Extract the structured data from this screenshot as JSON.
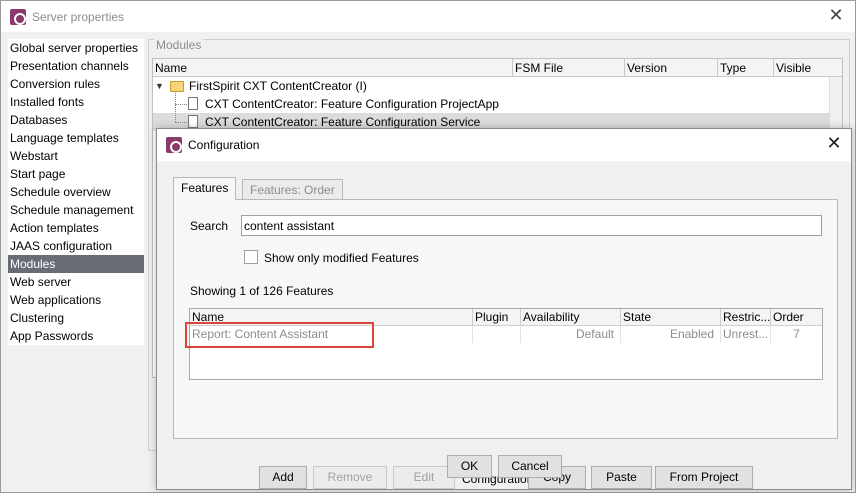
{
  "window": {
    "title": "Server properties"
  },
  "sidebar": {
    "items": [
      {
        "label": "Global server properties"
      },
      {
        "label": "Presentation channels"
      },
      {
        "label": "Conversion rules"
      },
      {
        "label": "Installed fonts"
      },
      {
        "label": "Databases"
      },
      {
        "label": "Language templates"
      },
      {
        "label": "Webstart"
      },
      {
        "label": "Start page"
      },
      {
        "label": "Schedule overview"
      },
      {
        "label": "Schedule management"
      },
      {
        "label": "Action templates"
      },
      {
        "label": "JAAS configuration"
      },
      {
        "label": "Modules",
        "selected": true
      },
      {
        "label": "Web server"
      },
      {
        "label": "Web applications"
      },
      {
        "label": "Clustering"
      },
      {
        "label": "App Passwords"
      }
    ]
  },
  "modules": {
    "legend": "Modules",
    "columns": [
      "Name",
      "FSM File",
      "Version",
      "Type",
      "Visible"
    ],
    "rows": [
      {
        "label": "FirstSpirit CXT ContentCreator (I)",
        "kind": "folder"
      },
      {
        "label": "CXT ContentCreator: Feature Configuration ProjectApp",
        "kind": "file"
      },
      {
        "label": "CXT ContentCreator: Feature Configuration Service",
        "kind": "file",
        "selected": true
      }
    ]
  },
  "dialog": {
    "title": "Configuration",
    "tabs": [
      {
        "label": "Features"
      },
      {
        "label": "Features: Order"
      }
    ],
    "search_label": "Search",
    "search_value": "content assistant",
    "checkbox_label": "Show only modified Features",
    "checkbox_checked": false,
    "showing_text": "Showing 1 of 126 Features",
    "table": {
      "columns": [
        "Name",
        "Plugin",
        "Availability",
        "State",
        "Restric...",
        "Order"
      ],
      "rows": [
        {
          "name": "Report: Content Assistant",
          "plugin": "",
          "availability": "Default",
          "state": "Enabled",
          "restrictions": "Unrest...",
          "order": "7"
        }
      ]
    },
    "buttons": {
      "add": "Add",
      "remove": "Remove",
      "edit": "Edit",
      "configuration_label": "Configuration:",
      "copy": "Copy",
      "paste": "Paste",
      "from_project": "From Project",
      "ok": "OK",
      "cancel": "Cancel"
    }
  },
  "colors": {
    "selection": "#686c74",
    "highlight": "#e0423a",
    "brand": "#8a3a6c"
  },
  "icons": [
    "app-icon",
    "close-icon",
    "folder-icon",
    "file-icon",
    "expand-arrow-icon"
  ]
}
